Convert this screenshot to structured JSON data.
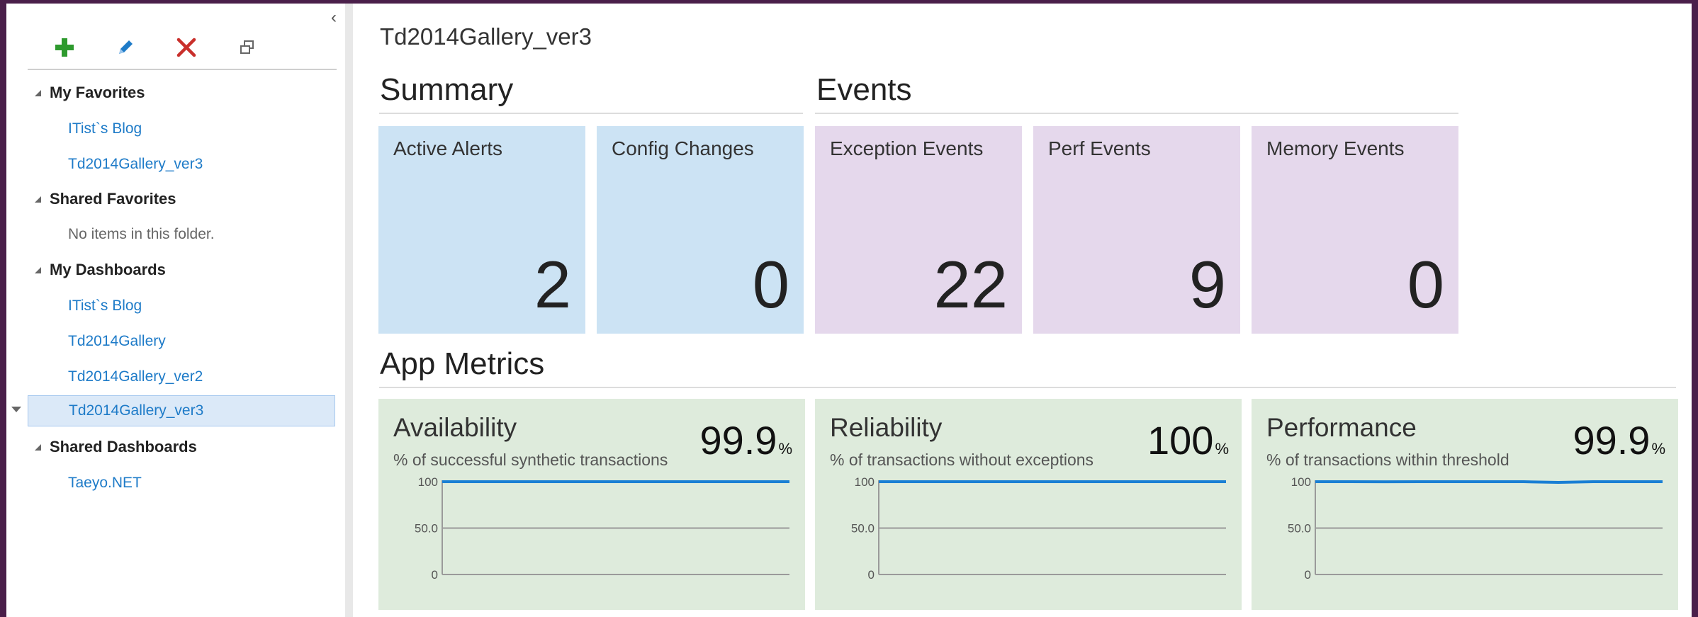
{
  "sidebar": {
    "toolbar": {
      "add": "plus-icon",
      "edit": "pencil-icon",
      "delete": "delete-x-icon",
      "detach": "window-restore-icon"
    },
    "sections": {
      "my_favorites": {
        "label": "My Favorites",
        "items": [
          "ITist`s Blog",
          "Td2014Gallery_ver3"
        ]
      },
      "shared_favorites": {
        "label": "Shared Favorites",
        "empty": "No items in this folder."
      },
      "my_dashboards": {
        "label": "My Dashboards",
        "items": [
          "ITist`s Blog",
          "Td2014Gallery",
          "Td2014Gallery_ver2",
          "Td2014Gallery_ver3"
        ],
        "selected": "Td2014Gallery_ver3"
      },
      "shared_dashboards": {
        "label": "Shared Dashboards",
        "items": [
          "Taeyo.NET"
        ]
      }
    }
  },
  "main": {
    "title": "Td2014Gallery_ver3",
    "summary": {
      "title": "Summary",
      "tiles": [
        {
          "label": "Active Alerts",
          "value": "2"
        },
        {
          "label": "Config Changes",
          "value": "0"
        }
      ]
    },
    "events": {
      "title": "Events",
      "tiles": [
        {
          "label": "Exception Events",
          "value": "22"
        },
        {
          "label": "Perf Events",
          "value": "9"
        },
        {
          "label": "Memory Events",
          "value": "0"
        }
      ]
    },
    "app_metrics": {
      "title": "App Metrics",
      "cards": [
        {
          "title": "Availability",
          "subtitle": "% of successful synthetic transactions",
          "value": "99.9",
          "unit": "%"
        },
        {
          "title": "Reliability",
          "subtitle": "% of transactions without exceptions",
          "value": "100",
          "unit": "%"
        },
        {
          "title": "Performance",
          "subtitle": "% of transactions within threshold",
          "value": "99.9",
          "unit": "%"
        }
      ]
    }
  },
  "chart_data": [
    {
      "type": "line",
      "y_ticks": [
        "100",
        "50.0",
        "0"
      ],
      "ylim": [
        0,
        100
      ],
      "series": [
        {
          "values": [
            100,
            100,
            100,
            100,
            100,
            100,
            100,
            100,
            100,
            100,
            100
          ]
        }
      ]
    },
    {
      "type": "line",
      "y_ticks": [
        "100",
        "50.0",
        "0"
      ],
      "ylim": [
        0,
        100
      ],
      "series": [
        {
          "values": [
            100,
            100,
            100,
            100,
            100,
            100,
            100,
            100,
            100,
            100,
            100
          ]
        }
      ]
    },
    {
      "type": "line",
      "y_ticks": [
        "100",
        "50.0",
        "0"
      ],
      "ylim": [
        0,
        100
      ],
      "series": [
        {
          "values": [
            100,
            100,
            99.9,
            100,
            100,
            100,
            100,
            99.2,
            100,
            100,
            100
          ]
        }
      ]
    }
  ],
  "colors": {
    "accent": "#1e7bc8",
    "line": "#1a7fd4",
    "summary_tile": "#cce3f4",
    "event_tile": "#e5d8ec",
    "metric_card": "#deebdc",
    "add": "#2e9a2e",
    "delete": "#c9302c"
  }
}
